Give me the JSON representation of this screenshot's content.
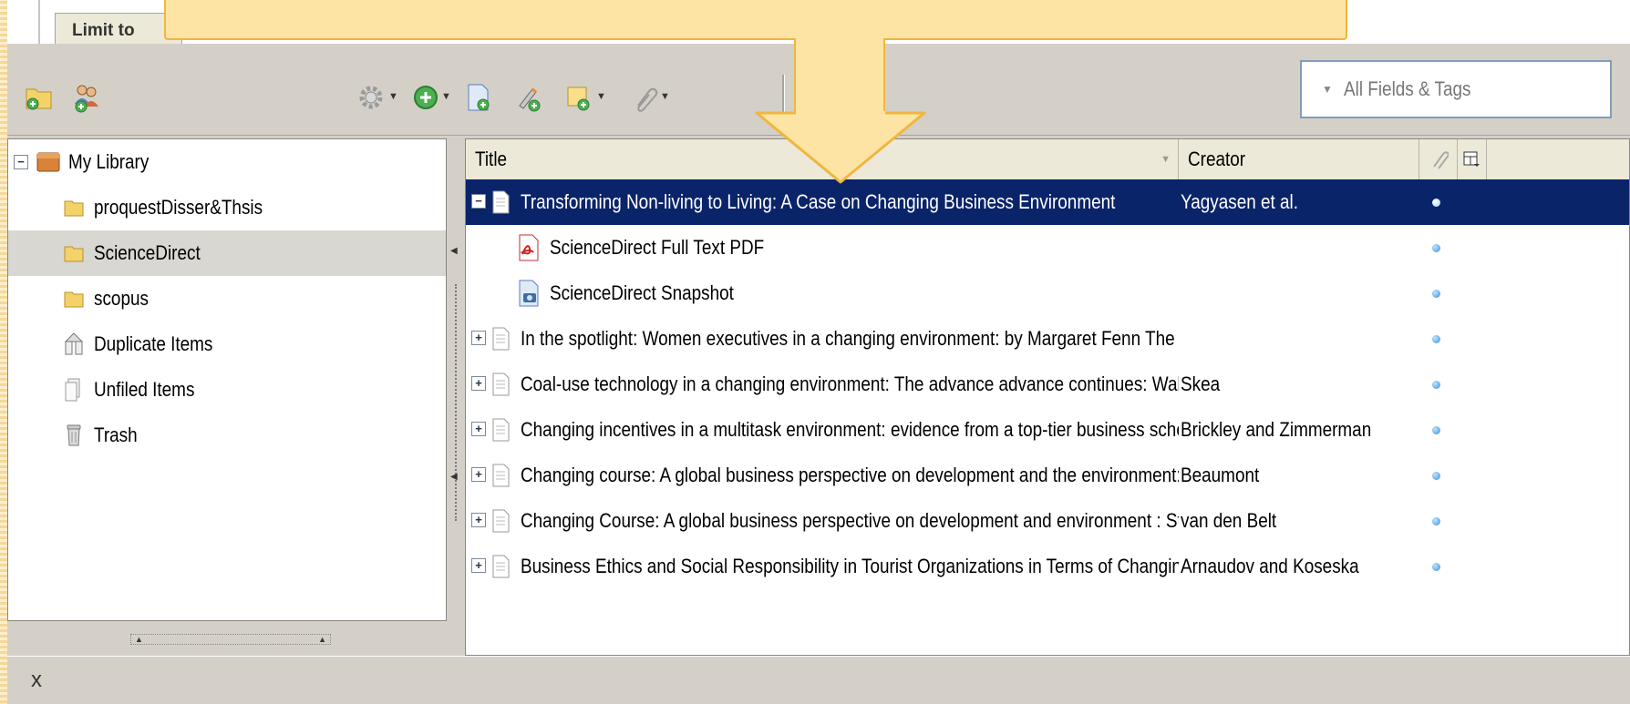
{
  "top": {
    "tab_label": "Limit to"
  },
  "search": {
    "dropdown_icon": "dropdown-triangle",
    "value": "All Fields & Tags"
  },
  "toolbar": {
    "icons": [
      "new-collection-icon",
      "new-group-icon",
      "actions-gear-icon",
      "new-item-icon",
      "add-item-by-identifier-icon",
      "new-note-icon",
      "add-attachment-icon",
      "attach-link-icon"
    ]
  },
  "collections": [
    {
      "label": "My Library",
      "icon": "library-icon",
      "expanded": true
    },
    {
      "label": "proquestDisser&Thsis",
      "icon": "folder-icon"
    },
    {
      "label": "ScienceDirect",
      "icon": "folder-icon",
      "selected": true
    },
    {
      "label": "scopus",
      "icon": "folder-icon"
    },
    {
      "label": "Duplicate Items",
      "icon": "duplicate-icon"
    },
    {
      "label": "Unfiled Items",
      "icon": "unfiled-icon"
    },
    {
      "label": "Trash",
      "icon": "trash-icon"
    }
  ],
  "columns": {
    "title": "Title",
    "creator": "Creator"
  },
  "items": [
    {
      "title": "Transforming Non-living to Living: A Case on Changing Business Environment",
      "creator": "Yagyasen et al.",
      "expander": "−",
      "selected": true,
      "type": "document"
    },
    {
      "title": "ScienceDirect Full Text PDF",
      "creator": "",
      "type": "pdf",
      "child": true
    },
    {
      "title": "ScienceDirect Snapshot",
      "creator": "",
      "type": "snapshot",
      "child": true
    },
    {
      "title": "In the spotlight: Women executives in a changing environment: by Margaret Fenn The r...",
      "creator": "",
      "expander": "+",
      "type": "document"
    },
    {
      "title": "Coal-use technology in a changing environment: The advance advance continues: Walte...",
      "creator": "Skea",
      "expander": "+",
      "type": "document"
    },
    {
      "title": "Changing incentives in a multitask environment: evidence from a top-tier business school",
      "creator": "Brickley and Zimmerman",
      "expander": "+",
      "type": "document"
    },
    {
      "title": "Changing course: A global business perspective on development and the environment: S...",
      "creator": "Beaumont",
      "expander": "+",
      "type": "document"
    },
    {
      "title": "Changing Course: A global business perspective on development and environment : Ste...",
      "creator": "van den Belt",
      "expander": "+",
      "type": "document"
    },
    {
      "title": "Business Ethics and Social Responsibility in Tourist Organizations in Terms of Changing E...",
      "creator": "Arnaudov and Koseska",
      "expander": "+",
      "type": "document"
    }
  ],
  "status": {
    "close_label": "x"
  }
}
